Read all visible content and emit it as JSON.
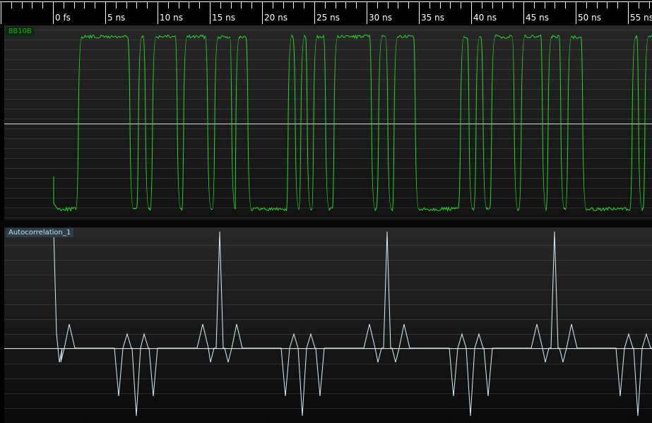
{
  "timeline": {
    "ticks": [
      "0 fs",
      "5 ns",
      "10 ns",
      "15 ns",
      "20 ns",
      "25 ns",
      "30 ns",
      "35 ns",
      "40 ns",
      "45 ns",
      "50 ns",
      "55 ns"
    ]
  },
  "channels": [
    {
      "name": "8B10B",
      "color": "#22dd22",
      "type": "digital-trace"
    },
    {
      "name": "Autocorrelation_1",
      "color": "#d6f1ff",
      "type": "analog-trace"
    }
  ],
  "colors": {
    "background": "#000000",
    "grid": "#5a5a5a",
    "ruler_text": "#ffffff"
  }
}
